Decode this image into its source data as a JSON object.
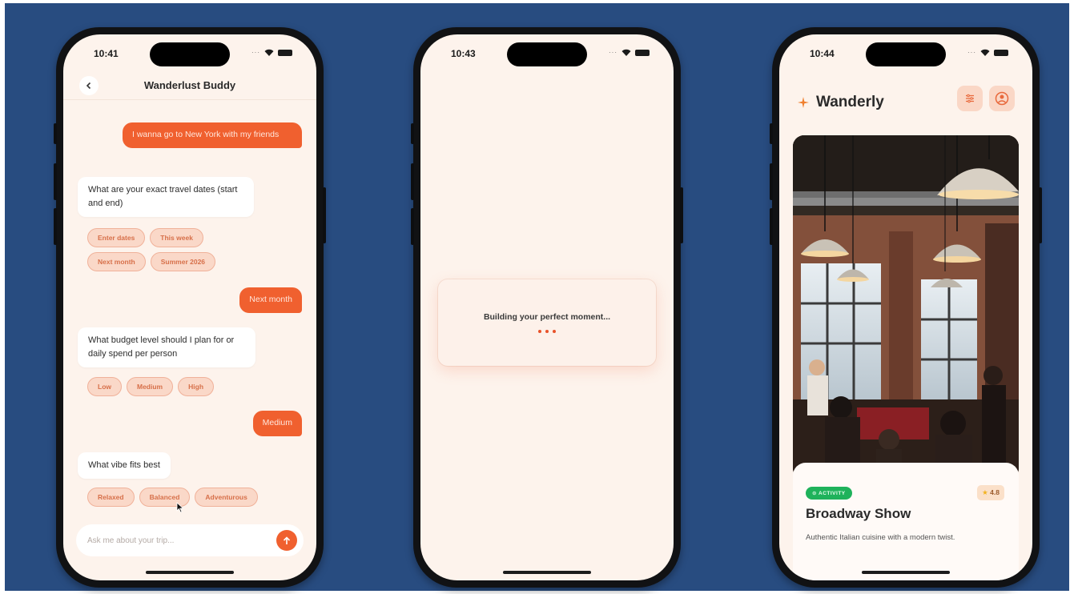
{
  "phone1": {
    "time": "10:41",
    "chat_title": "Wanderlust Buddy",
    "back_icon": "chevron-left-icon",
    "messages": [
      {
        "from": "user",
        "text": "I wanna go to New York with my friends"
      },
      {
        "from": "bot",
        "text": "What are your exact travel dates (start and end)"
      },
      {
        "from": "user",
        "text": "Next month"
      },
      {
        "from": "bot",
        "text": "What budget level should I plan for or daily spend per person"
      },
      {
        "from": "user",
        "text": "Medium"
      },
      {
        "from": "bot",
        "text": "What vibe fits best"
      }
    ],
    "chips_dates": [
      "Enter dates",
      "This week",
      "Next month",
      "Summer 2026"
    ],
    "chips_budget": [
      "Low",
      "Medium",
      "High"
    ],
    "chips_vibe": [
      "Relaxed",
      "Balanced",
      "Adventurous"
    ],
    "input_placeholder": "Ask me about your trip...",
    "send_icon": "arrow-up-icon"
  },
  "phone2": {
    "time": "10:43",
    "loading_text": "Building your perfect moment..."
  },
  "phone3": {
    "time": "10:44",
    "brand": "Wanderly",
    "brand_icon": "sparkle-icon",
    "filter_icon": "filter-icon",
    "profile_icon": "profile-icon",
    "tag": "ACTIVITY",
    "rating": "4.8",
    "title": "Broadway Show",
    "description": "Authentic Italian cuisine with a modern twist."
  },
  "colors": {
    "background": "#284c80",
    "accent": "#f0602f",
    "screen": "#fdf3ec",
    "tag_green": "#1fb25b"
  }
}
